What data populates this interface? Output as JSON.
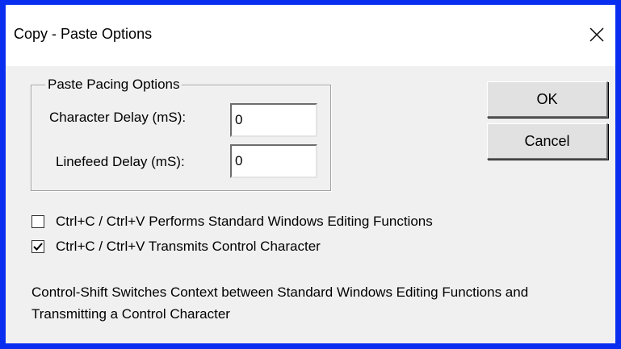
{
  "window": {
    "title": "Copy - Paste Options",
    "close_symbol": "close-icon"
  },
  "pacing": {
    "group_label": "Paste Pacing Options",
    "char_delay_label": "Character Delay (mS):",
    "char_delay_value": "0",
    "linefeed_delay_label": "Linefeed Delay  (mS):",
    "linefeed_delay_value": "0"
  },
  "buttons": {
    "ok": "OK",
    "cancel": "Cancel"
  },
  "options": [
    {
      "label": "Ctrl+C / Ctrl+V Performs Standard Windows Editing Functions",
      "checked": false
    },
    {
      "label": "Ctrl+C / Ctrl+V Transmits Control Character",
      "checked": true
    }
  ],
  "note": "Control-Shift Switches Context between Standard Windows Editing Functions and Transmitting a Control Character",
  "colors": {
    "border_accent": "#0a2ef0",
    "dialog_bg": "#f0f0f0",
    "titlebar_bg": "#ffffff"
  }
}
